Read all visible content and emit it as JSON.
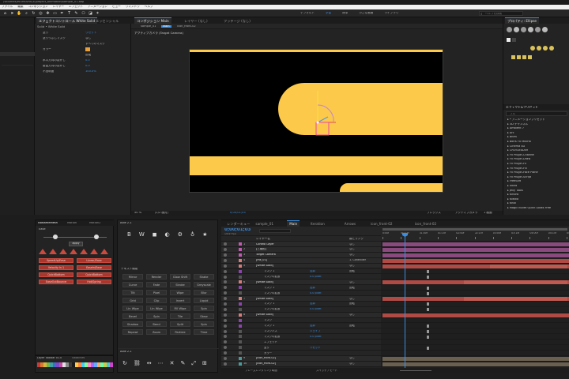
{
  "window": {
    "title_path": "/Volumes/WORKSPACE/project_animation/sample_01.aep",
    "menu": [
      "ファイル",
      "編集",
      "コンポジション",
      "レイヤー",
      "エフェクト",
      "アニメーション",
      "ビュー",
      "ウィンドウ",
      "ヘルプ"
    ]
  },
  "toolbar": {
    "workspace_tabs": [
      "デフォルト",
      "学習",
      "標準",
      "小さな画面",
      "ライブラリ"
    ],
    "search_placeholder": "ヘルプを検索"
  },
  "effect_controls": {
    "tabs": [
      "エフェクトコントロール White Solid",
      "エッセンシャル"
    ],
    "subheader": "Solid • White Solid",
    "rows": [
      {
        "label": "塗り",
        "value": "リセット"
      },
      {
        "label": "塗りつぶしマスク",
        "value": "なし"
      },
      {
        "label": "",
        "value": "すべてのマスク"
      },
      {
        "label": "カラー",
        "value": ""
      },
      {
        "label": "",
        "value": "反転"
      },
      {
        "label": "水平方向のぼかし",
        "value": "0.0"
      },
      {
        "label": "垂直方向のぼかし",
        "value": "0.0"
      },
      {
        "label": "不透明度",
        "value": "100.0%"
      }
    ]
  },
  "composition": {
    "tabs": [
      "コンポジション Main",
      "レイヤー (なし)",
      "フッテージ (なし)"
    ],
    "subtabs": [
      "sample_01",
      "Main",
      "icon_front-02"
    ],
    "camera_label": "アクティブカメラ (Target Camera)",
    "zoom": "50 %",
    "quality": "(1/2 画質)",
    "timecode": "0;00;01;03",
    "view_mode": "フレックス",
    "render_mode": "クラシック 3D",
    "view_count": "1 画面",
    "active_camera": "アクティブカメラ"
  },
  "properties": {
    "header": "プロパティ: Ellipse",
    "section1": "エフェクト&プリセット",
    "tags": [
      "Link",
      "Tx",
      "Ae"
    ],
    "search_placeholder": "フル",
    "fx_list": [
      "* アニメーションプリセット",
      "3D チャンネル",
      "Ambient 7",
      "Arc",
      "BBPA",
      "Boris FX Mocha",
      "Cinema 4D",
      "CROSSFADER",
      "Fx Plugin-Channel",
      "Fx Plugin-Draw",
      "Fx Plugin-Fx",
      "Fx Plugin-Fill",
      "Fx Plugin-Face Plane",
      "Fx Plugin-Script",
      "FreeSoft",
      "Intels",
      "Jelly Tools",
      "Kinora",
      "Kiwiko",
      "Knoll",
      "Magic Bullet Quick Looks Free"
    ]
  },
  "shape_panel": {
    "tabs": [
      "NoNameMesh",
      "Motion",
      "Motion2"
    ],
    "title": "Ease",
    "apply_label": "apply",
    "buttons": [
      "SpeedUp/Ease",
      "Linear/Ease",
      "Velocity In 1",
      "EaseIn/Ease",
      "QuickBottom",
      "QuickBottom",
      "EaseOutBounce",
      "Hot/Spring"
    ]
  },
  "text_panel": {
    "header": "Allie 2.1",
    "tools_header": "テキスト機能",
    "buttons": [
      "Mirror",
      "Render",
      "Glow Shift",
      "Shake",
      "Curve",
      "Fade",
      "Stroke",
      "Greyscale",
      "Tilt",
      "Pixel",
      "Wipe",
      "Blur",
      "Grid",
      "Clip",
      "Invert",
      "Liquid",
      "Lin Wipe",
      "Lin Wipe",
      "Fill Wipe",
      "Spin",
      "Bevel",
      "Spin",
      "Tile",
      "Skew",
      "Shadow",
      "Bend",
      "Split",
      "Spin",
      "Repeat",
      "Zoom",
      "Particle",
      "Time"
    ]
  },
  "swatch_panel": {
    "label": "Layer Toolbar v1.0",
    "sub": "Swatches",
    "colors": [
      "#c93a3a",
      "#d67b2e",
      "#d9b73d",
      "#6fb64a",
      "#3da1a1",
      "#3d6fc9",
      "#7b4ac9",
      "#c94aa8",
      "#e0e0e0",
      "#8a8a8a",
      "#3a3a3a",
      "#1a1a1a",
      "#ffcc44",
      "#ff8844",
      "#44ccff",
      "#88ff88",
      "#ff88cc",
      "#aa66ff",
      "#66aaff",
      "#ffaa66",
      "#66ffaa",
      "#cccc44",
      "#44cccc",
      "#cc44cc"
    ]
  },
  "timeline": {
    "tabs": [
      "レンダーキュー",
      "sample_01",
      "Main",
      "Iteration",
      "Arrows",
      "icon_front-02",
      "icon_front-02"
    ],
    "timecode": "0;00;01;03",
    "fps_label": "(29.97 fps)",
    "col_layer": "レイヤー名",
    "col_parent": "親とリンク",
    "col_mode": "モード",
    "ruler": [
      "0:00f",
      "00:15f",
      "01:00f",
      "01:15f",
      "02:00f",
      "02:15f",
      "03:00f",
      "03:15f",
      "04:00f",
      "04:15f",
      "05:00f"
    ],
    "layers": [
      {
        "num": "1",
        "name": "Control Layer",
        "color": "#c15ab1",
        "value": "",
        "parent": "なし"
      },
      {
        "num": "2",
        "name": "[三角形]",
        "color": "#c15ab1",
        "value": "",
        "parent": "なし"
      },
      {
        "num": "3",
        "name": "Target Camera",
        "color": "#c15ab1",
        "value": "",
        "parent": "なし"
      },
      {
        "num": "4",
        "name": "[mk_01]",
        "color": "#d77b7b",
        "value": "",
        "parent": "1. Controller"
      },
      {
        "num": "5",
        "name": "[White Solid]",
        "color": "#d77b7b",
        "value": "",
        "parent": "なし"
      },
      {
        "num": "",
        "name": "マスク 1",
        "color": "#8e44ad",
        "value": "加算",
        "parent": "反転"
      },
      {
        "num": "",
        "name": "マスクの拡張",
        "color": "#555",
        "value": "0.0 pixel",
        "parent": ""
      },
      {
        "num": "6",
        "name": "[White Solid]",
        "color": "#d77b7b",
        "value": "",
        "parent": "なし"
      },
      {
        "num": "",
        "name": "マスク 1",
        "color": "#8e44ad",
        "value": "加算",
        "parent": "反転"
      },
      {
        "num": "",
        "name": "マスクの拡張",
        "color": "#555",
        "value": "0.0 pixel",
        "parent": ""
      },
      {
        "num": "7",
        "name": "[White Solid]",
        "color": "#d77b7b",
        "value": "",
        "parent": "なし"
      },
      {
        "num": "",
        "name": "マスク 1",
        "color": "#8e44ad",
        "value": "加算",
        "parent": "反転"
      },
      {
        "num": "",
        "name": "マスクの拡張",
        "color": "#555",
        "value": "0.0 pixel",
        "parent": ""
      },
      {
        "num": "8",
        "name": "[White Solid]",
        "color": "#d77b7b",
        "value": "",
        "parent": "なし"
      },
      {
        "num": "",
        "name": "マスク",
        "color": "#8e44ad",
        "value": "",
        "parent": ""
      },
      {
        "num": "",
        "name": "マスク 1",
        "color": "#8e44ad",
        "value": "加算",
        "parent": "反転"
      },
      {
        "num": "",
        "name": "マスクパス",
        "color": "#555",
        "value": "シェイプ",
        "parent": ""
      },
      {
        "num": "",
        "name": "マスクの拡張",
        "color": "#555",
        "value": "0.0 pixel",
        "parent": ""
      },
      {
        "num": "",
        "name": "エフェクト",
        "color": "#555",
        "value": "",
        "parent": ""
      },
      {
        "num": "",
        "name": "塗り",
        "color": "#555",
        "value": "リセット",
        "parent": ""
      },
      {
        "num": "",
        "name": "カラー",
        "color": "#555",
        "value": "",
        "parent": ""
      },
      {
        "num": "9",
        "name": "[icon_front-02]",
        "color": "#4a9a9a",
        "value": "",
        "parent": "なし"
      },
      {
        "num": "10",
        "name": "[icon_front-02]",
        "color": "#4a9a9a",
        "value": "",
        "parent": "なし"
      }
    ],
    "footer_left": "フレームレンダリング時間",
    "footer_right": "スイッチ / モード"
  },
  "colors": {
    "accent": "#3b8de0",
    "shape_yellow": "#fcc94a",
    "keyframe": "#d7a43c"
  }
}
